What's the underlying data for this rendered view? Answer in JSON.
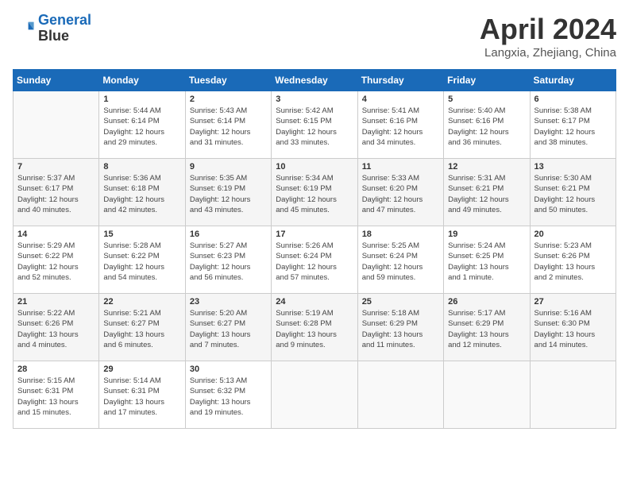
{
  "header": {
    "logo_line1": "General",
    "logo_line2": "Blue",
    "month_year": "April 2024",
    "location": "Langxia, Zhejiang, China"
  },
  "weekdays": [
    "Sunday",
    "Monday",
    "Tuesday",
    "Wednesday",
    "Thursday",
    "Friday",
    "Saturday"
  ],
  "weeks": [
    [
      {
        "day": "",
        "info": ""
      },
      {
        "day": "1",
        "info": "Sunrise: 5:44 AM\nSunset: 6:14 PM\nDaylight: 12 hours\nand 29 minutes."
      },
      {
        "day": "2",
        "info": "Sunrise: 5:43 AM\nSunset: 6:14 PM\nDaylight: 12 hours\nand 31 minutes."
      },
      {
        "day": "3",
        "info": "Sunrise: 5:42 AM\nSunset: 6:15 PM\nDaylight: 12 hours\nand 33 minutes."
      },
      {
        "day": "4",
        "info": "Sunrise: 5:41 AM\nSunset: 6:16 PM\nDaylight: 12 hours\nand 34 minutes."
      },
      {
        "day": "5",
        "info": "Sunrise: 5:40 AM\nSunset: 6:16 PM\nDaylight: 12 hours\nand 36 minutes."
      },
      {
        "day": "6",
        "info": "Sunrise: 5:38 AM\nSunset: 6:17 PM\nDaylight: 12 hours\nand 38 minutes."
      }
    ],
    [
      {
        "day": "7",
        "info": "Sunrise: 5:37 AM\nSunset: 6:17 PM\nDaylight: 12 hours\nand 40 minutes."
      },
      {
        "day": "8",
        "info": "Sunrise: 5:36 AM\nSunset: 6:18 PM\nDaylight: 12 hours\nand 42 minutes."
      },
      {
        "day": "9",
        "info": "Sunrise: 5:35 AM\nSunset: 6:19 PM\nDaylight: 12 hours\nand 43 minutes."
      },
      {
        "day": "10",
        "info": "Sunrise: 5:34 AM\nSunset: 6:19 PM\nDaylight: 12 hours\nand 45 minutes."
      },
      {
        "day": "11",
        "info": "Sunrise: 5:33 AM\nSunset: 6:20 PM\nDaylight: 12 hours\nand 47 minutes."
      },
      {
        "day": "12",
        "info": "Sunrise: 5:31 AM\nSunset: 6:21 PM\nDaylight: 12 hours\nand 49 minutes."
      },
      {
        "day": "13",
        "info": "Sunrise: 5:30 AM\nSunset: 6:21 PM\nDaylight: 12 hours\nand 50 minutes."
      }
    ],
    [
      {
        "day": "14",
        "info": "Sunrise: 5:29 AM\nSunset: 6:22 PM\nDaylight: 12 hours\nand 52 minutes."
      },
      {
        "day": "15",
        "info": "Sunrise: 5:28 AM\nSunset: 6:22 PM\nDaylight: 12 hours\nand 54 minutes."
      },
      {
        "day": "16",
        "info": "Sunrise: 5:27 AM\nSunset: 6:23 PM\nDaylight: 12 hours\nand 56 minutes."
      },
      {
        "day": "17",
        "info": "Sunrise: 5:26 AM\nSunset: 6:24 PM\nDaylight: 12 hours\nand 57 minutes."
      },
      {
        "day": "18",
        "info": "Sunrise: 5:25 AM\nSunset: 6:24 PM\nDaylight: 12 hours\nand 59 minutes."
      },
      {
        "day": "19",
        "info": "Sunrise: 5:24 AM\nSunset: 6:25 PM\nDaylight: 13 hours\nand 1 minute."
      },
      {
        "day": "20",
        "info": "Sunrise: 5:23 AM\nSunset: 6:26 PM\nDaylight: 13 hours\nand 2 minutes."
      }
    ],
    [
      {
        "day": "21",
        "info": "Sunrise: 5:22 AM\nSunset: 6:26 PM\nDaylight: 13 hours\nand 4 minutes."
      },
      {
        "day": "22",
        "info": "Sunrise: 5:21 AM\nSunset: 6:27 PM\nDaylight: 13 hours\nand 6 minutes."
      },
      {
        "day": "23",
        "info": "Sunrise: 5:20 AM\nSunset: 6:27 PM\nDaylight: 13 hours\nand 7 minutes."
      },
      {
        "day": "24",
        "info": "Sunrise: 5:19 AM\nSunset: 6:28 PM\nDaylight: 13 hours\nand 9 minutes."
      },
      {
        "day": "25",
        "info": "Sunrise: 5:18 AM\nSunset: 6:29 PM\nDaylight: 13 hours\nand 11 minutes."
      },
      {
        "day": "26",
        "info": "Sunrise: 5:17 AM\nSunset: 6:29 PM\nDaylight: 13 hours\nand 12 minutes."
      },
      {
        "day": "27",
        "info": "Sunrise: 5:16 AM\nSunset: 6:30 PM\nDaylight: 13 hours\nand 14 minutes."
      }
    ],
    [
      {
        "day": "28",
        "info": "Sunrise: 5:15 AM\nSunset: 6:31 PM\nDaylight: 13 hours\nand 15 minutes."
      },
      {
        "day": "29",
        "info": "Sunrise: 5:14 AM\nSunset: 6:31 PM\nDaylight: 13 hours\nand 17 minutes."
      },
      {
        "day": "30",
        "info": "Sunrise: 5:13 AM\nSunset: 6:32 PM\nDaylight: 13 hours\nand 19 minutes."
      },
      {
        "day": "",
        "info": ""
      },
      {
        "day": "",
        "info": ""
      },
      {
        "day": "",
        "info": ""
      },
      {
        "day": "",
        "info": ""
      }
    ]
  ]
}
